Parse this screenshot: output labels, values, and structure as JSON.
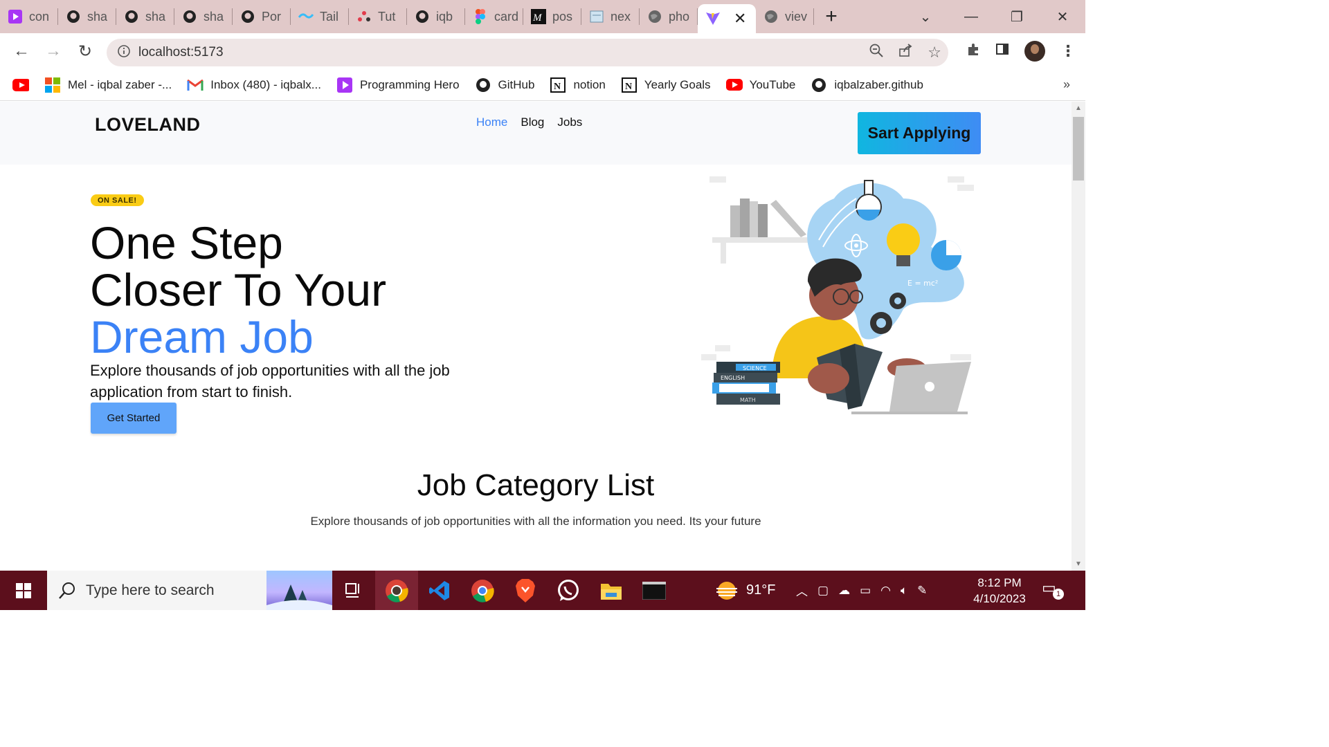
{
  "browser": {
    "tabs": [
      {
        "title": "con",
        "icon": "programming-hero-icon",
        "color": "#a835f5"
      },
      {
        "title": "sha",
        "icon": "github-icon"
      },
      {
        "title": "sha",
        "icon": "github-icon"
      },
      {
        "title": "sha",
        "icon": "github-icon"
      },
      {
        "title": "Por",
        "icon": "github-icon"
      },
      {
        "title": "Tail",
        "icon": "tailwind-icon",
        "color": "#38bdf8"
      },
      {
        "title": "Tut",
        "icon": "tutorial-icon",
        "color": "#e23b4b"
      },
      {
        "title": "iqb",
        "icon": "github-icon"
      },
      {
        "title": "card",
        "icon": "figma-icon"
      },
      {
        "title": "pos",
        "icon": "medium-icon"
      },
      {
        "title": "nex",
        "icon": "page-icon"
      },
      {
        "title": "pho",
        "icon": "globe-icon"
      },
      {
        "title": "",
        "icon": "vite-icon",
        "active": true
      },
      {
        "title": "viev",
        "icon": "globe-icon"
      }
    ],
    "url": "localhost:5173",
    "bookmarks": [
      {
        "label": "",
        "icon": "youtube-icon"
      },
      {
        "label": "Mel - iqbal zaber -...",
        "icon": "microsoft-icon"
      },
      {
        "label": "Inbox (480) - iqbalx...",
        "icon": "gmail-icon"
      },
      {
        "label": "Programming Hero",
        "icon": "programming-hero-icon"
      },
      {
        "label": "GitHub",
        "icon": "github-icon"
      },
      {
        "label": "notion",
        "icon": "notion-icon"
      },
      {
        "label": "Yearly Goals",
        "icon": "notion-icon"
      },
      {
        "label": "YouTube",
        "icon": "youtube-icon"
      },
      {
        "label": "iqbalzaber.github",
        "icon": "github-icon"
      }
    ],
    "more": "»"
  },
  "site": {
    "logo": "LOVELAND",
    "nav": [
      "Home",
      "Blog",
      "Jobs"
    ],
    "cta": "Sart Applying",
    "badge": "ON SALE!",
    "hero_line1": "One Step",
    "hero_line2": "Closer To Your",
    "hero_accent": "Dream Job",
    "hero_desc": "Explore thousands of job opportunities with all the job application from start to finish.",
    "start_button": "Get Started",
    "illustration_books": [
      "SCIENCE",
      "ENGLISH",
      "MATH"
    ],
    "illustration_formula": "E = mc²",
    "section_title": "Job Category List",
    "section_sub": "Explore thousands of job opportunities with all the information you need. Its your future",
    "accent_color": "#3b82f6"
  },
  "taskbar": {
    "search_placeholder": "Type here to search",
    "weather": "91°F",
    "time": "8:12 PM",
    "date": "4/10/2023",
    "notifications": "1"
  }
}
